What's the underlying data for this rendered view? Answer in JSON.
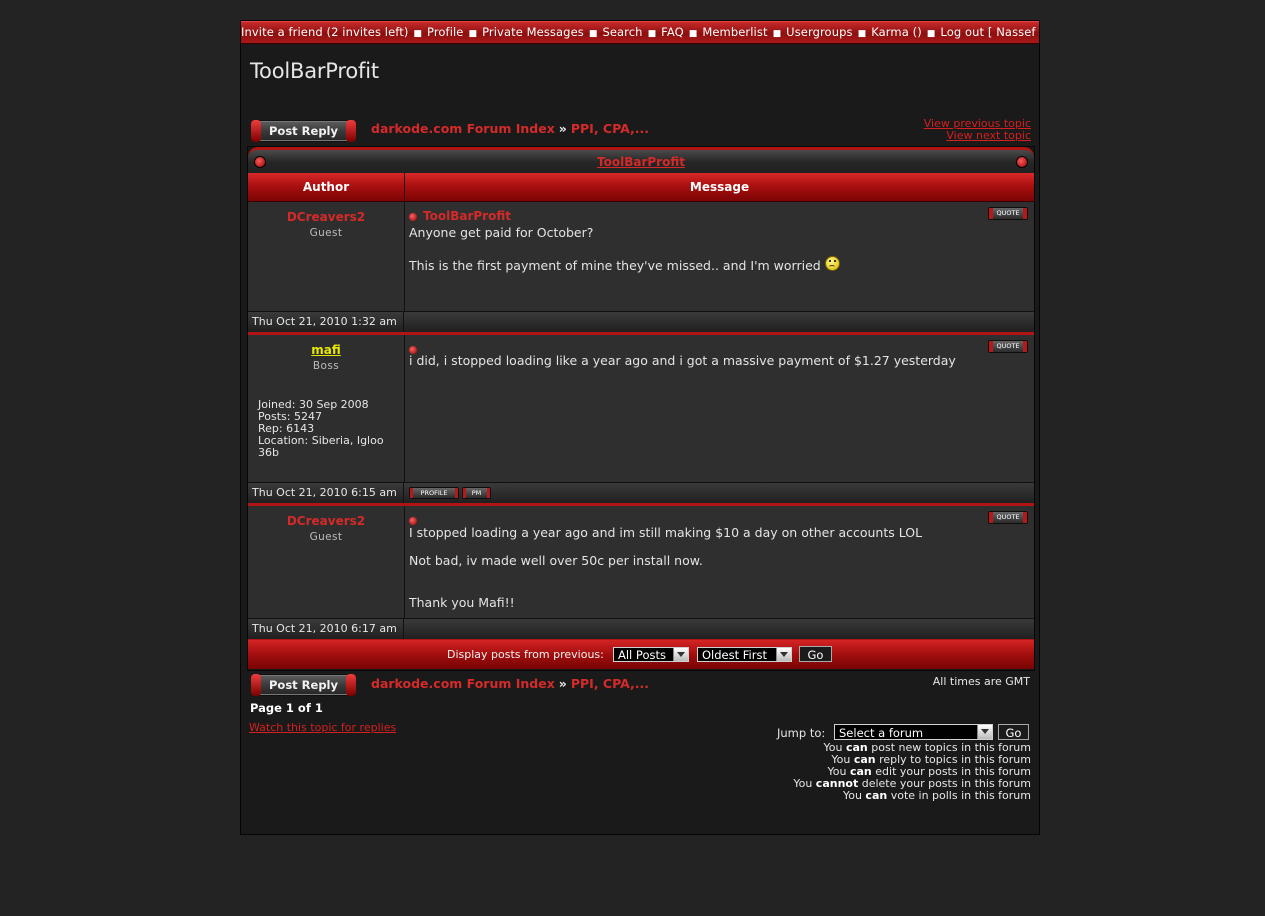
{
  "nav": {
    "items": [
      "Invite a friend (2 invites left)",
      "Profile",
      "Private Messages",
      "Search",
      "FAQ",
      "Memberlist",
      "Usergroups",
      "Karma ()",
      "Log out [ Nassef ]"
    ],
    "separator": "■"
  },
  "topic": {
    "title": "ToolBarProfit",
    "post_reply_label": "Post Reply",
    "breadcrumb": [
      "darkode.com Forum Index",
      "PPI, CPA,..."
    ],
    "breadcrumb_sep": "»",
    "prev_topic": "View previous topic",
    "next_topic": "View next topic"
  },
  "table": {
    "header_title": "ToolBarProfit",
    "col_author": "Author",
    "col_message": "Message"
  },
  "posts": [
    {
      "author": "DCreavers2",
      "rank": "Guest",
      "subject": "ToolBarProfit",
      "body": [
        "Anyone get paid for October?",
        "This is the first payment of mine they've missed.. and I'm worried"
      ],
      "date": "Thu Oct 21, 2010 1:32 am",
      "quote_label": "QUOTE"
    },
    {
      "author": "mafi",
      "rank": "Boss",
      "info": [
        "Joined: 30 Sep 2008",
        "Posts: 5247",
        "Rep: 6143",
        "Location: Siberia, Igloo 36b"
      ],
      "subject": "",
      "body": [
        "i did, i stopped loading like a year ago and i got a massive payment of $1.27 yesterday"
      ],
      "date": "Thu Oct 21, 2010 6:15 am",
      "quote_label": "QUOTE",
      "profile_label": "PROFILE",
      "pm_label": "PM"
    },
    {
      "author": "DCreavers2",
      "rank": "Guest",
      "subject": "",
      "body": [
        "I stopped loading a year ago and im still making $10 a day on other accounts LOL",
        "Not bad, iv made well over 50c per install now.",
        "Thank you Mafi!!"
      ],
      "date": "Thu Oct 21, 2010 6:17 am",
      "quote_label": "QUOTE"
    }
  ],
  "display": {
    "label": "Display posts from previous:",
    "posts_value": "All Posts",
    "order_value": "Oldest First",
    "go": "Go"
  },
  "footer": {
    "all_times": "All times are GMT",
    "page_info": "Page 1 of 1",
    "watch": "Watch this topic for replies",
    "jump_label": "Jump to:",
    "jump_value": "Select a forum",
    "jump_go": "Go",
    "permissions": [
      [
        "You ",
        "can",
        " post new topics in this forum"
      ],
      [
        "You ",
        "can",
        " reply to topics in this forum"
      ],
      [
        "You ",
        "can",
        " edit your posts in this forum"
      ],
      [
        "You ",
        "cannot",
        " delete your posts in this forum"
      ],
      [
        "You ",
        "can",
        " vote in polls in this forum"
      ]
    ]
  },
  "colors": {
    "accent": "#d42a2a",
    "bar_red": "#a60e0e",
    "boss_name": "#e8e800",
    "bg": "#232323"
  }
}
